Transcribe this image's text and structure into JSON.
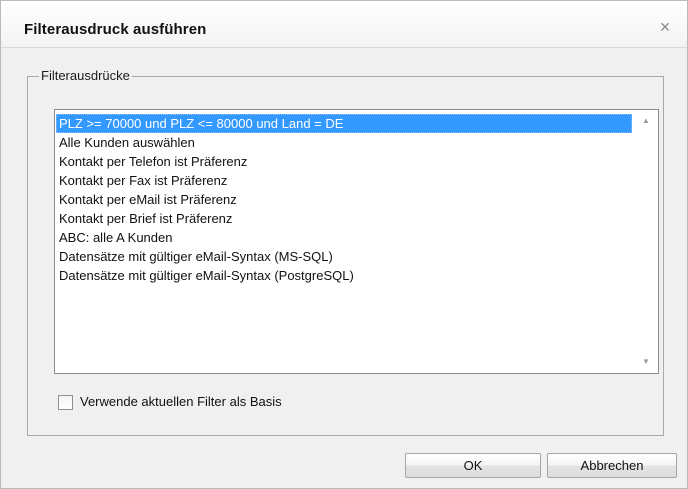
{
  "dialog": {
    "title": "Filterausdruck ausführen",
    "close_glyph": "×"
  },
  "group": {
    "legend": "Filterausdrücke"
  },
  "filters": [
    "PLZ >= 70000 und PLZ <= 80000 und Land = DE",
    "Alle Kunden auswählen",
    "Kontakt per Telefon ist Präferenz",
    "Kontakt per Fax ist Präferenz",
    "Kontakt per eMail ist Präferenz",
    "Kontakt per Brief ist Präferenz",
    "ABC: alle A Kunden",
    "Datensätze mit gültiger eMail-Syntax (MS-SQL)",
    "Datensätze mit gültiger eMail-Syntax (PostgreSQL)"
  ],
  "selected_index": 0,
  "scroll": {
    "up_glyph": "▲",
    "down_glyph": "▼"
  },
  "option": {
    "label": "Verwende aktuellen Filter als Basis",
    "checked": false
  },
  "buttons": {
    "ok_label": "OK",
    "cancel_label": "Abbrechen"
  },
  "colors": {
    "selection": "#3399ff",
    "dialog_bg": "#f0f0f0"
  },
  "icons": {
    "close": "close-icon",
    "scroll_up": "chevron-up-icon",
    "scroll_down": "chevron-down-icon"
  }
}
